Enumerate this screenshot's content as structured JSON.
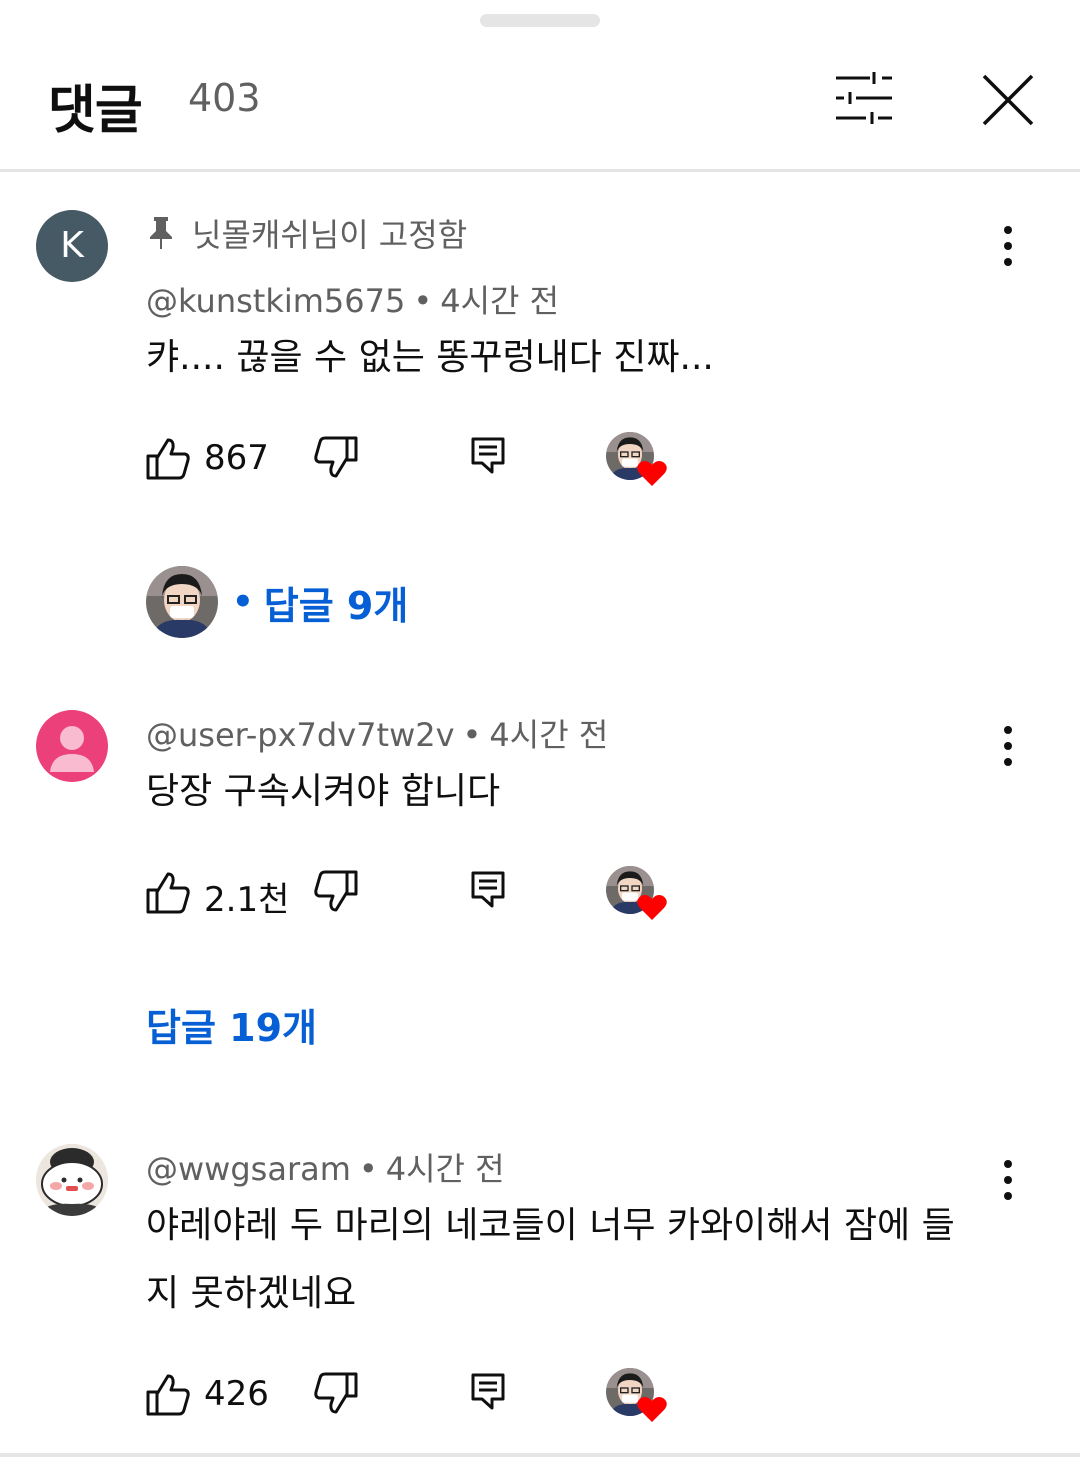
{
  "header": {
    "title": "댓글",
    "count": "403"
  },
  "colors": {
    "link": "#065fd4",
    "meta": "#606060",
    "heart": "#ff0000"
  },
  "comments": [
    {
      "pinned_label": "닛몰캐쉬님이 고정함",
      "author": "@kunstkim5675",
      "time": "4시간 전",
      "text": "캬.... 끊을 수 없는 똥꾸렁내다 진짜...",
      "likes": "867",
      "replies": "답글 9개",
      "avatar_letter": "K"
    },
    {
      "author": "@user-px7dv7tw2v",
      "time": "4시간 전",
      "text": "당장 구속시켜야 합니다",
      "likes": "2.1천",
      "replies": "답글 19개"
    },
    {
      "author": "@wwgsaram",
      "time": "4시간 전",
      "text": "야레야레 두 마리의 네코들이 너무 카와이해서 잠에 들지 못하겠네요",
      "likes": "426"
    }
  ],
  "icons": {
    "filter": "sliders-icon",
    "close": "close-icon",
    "pin": "pin-icon",
    "more": "more-vert-icon",
    "like": "thumb-up-icon",
    "dislike": "thumb-down-icon",
    "reply": "reply-icon",
    "creator_heart": "creator-heart-icon"
  }
}
